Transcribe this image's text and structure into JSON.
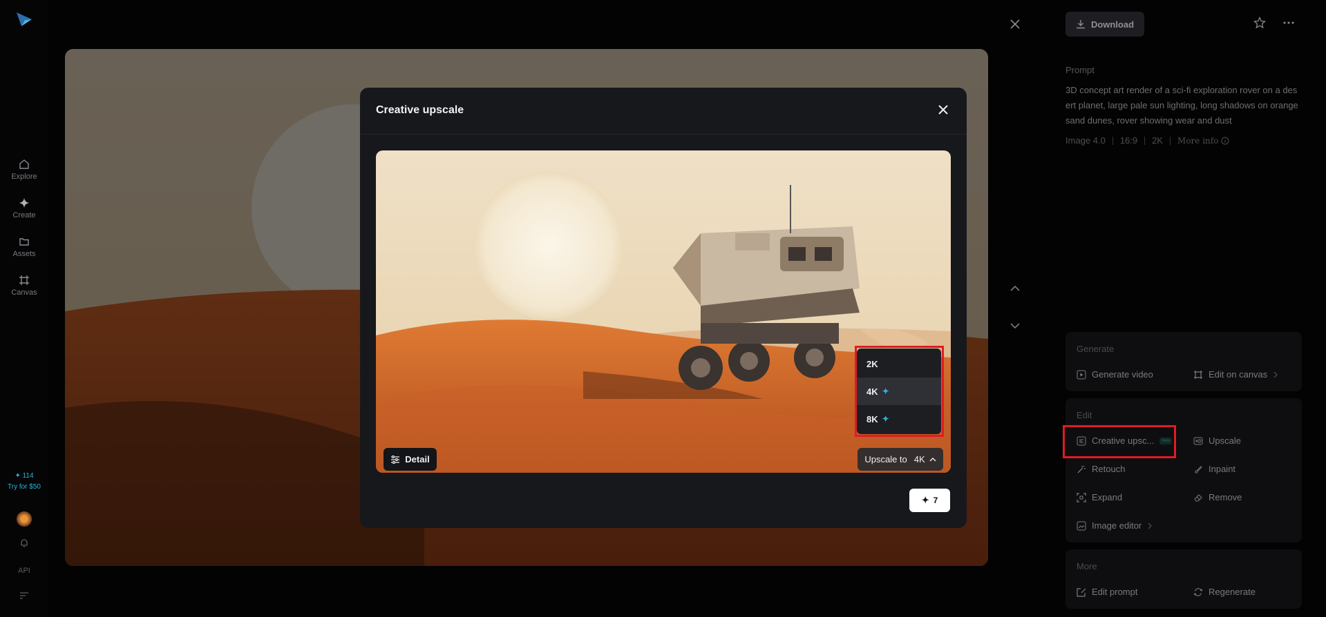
{
  "sidebar": {
    "items": [
      {
        "label": "Explore",
        "icon": "home-icon"
      },
      {
        "label": "Create",
        "icon": "sparkle-icon"
      },
      {
        "label": "Assets",
        "icon": "folder-icon"
      },
      {
        "label": "Canvas",
        "icon": "canvas-icon"
      }
    ],
    "credits_count": "114",
    "credits_offer": "Try for $50",
    "api_label": "API"
  },
  "header": {
    "download_label": "Download"
  },
  "prompt": {
    "label": "Prompt",
    "text": "3D concept art render of a sci-fi exploration rover on a desert planet, large pale sun lighting, long shadows on orange sand dunes, rover showing wear and dust",
    "model": "Image 4.0",
    "aspect": "16:9",
    "resolution": "2K",
    "more_info": "More info"
  },
  "generate_section": {
    "title": "Generate",
    "generate_video": "Generate video",
    "edit_on_canvas": "Edit on canvas"
  },
  "edit_section": {
    "title": "Edit",
    "creative_upscale": "Creative upsc...",
    "new_badge": "New",
    "upscale": "Upscale",
    "retouch": "Retouch",
    "inpaint": "Inpaint",
    "expand": "Expand",
    "remove": "Remove",
    "image_editor": "Image editor"
  },
  "more_section": {
    "title": "More",
    "edit_prompt": "Edit prompt",
    "regenerate": "Regenerate"
  },
  "modal": {
    "title": "Creative upscale",
    "detail_label": "Detail",
    "upscale_prefix": "Upscale to",
    "upscale_value": "4K",
    "options": [
      "2K",
      "4K",
      "8K"
    ],
    "selected_option": "4K",
    "cost": "7"
  },
  "colors": {
    "accent_cyan": "#2bb6d8",
    "highlight_red": "#e01b24",
    "sand_orange": "#d9692a"
  }
}
